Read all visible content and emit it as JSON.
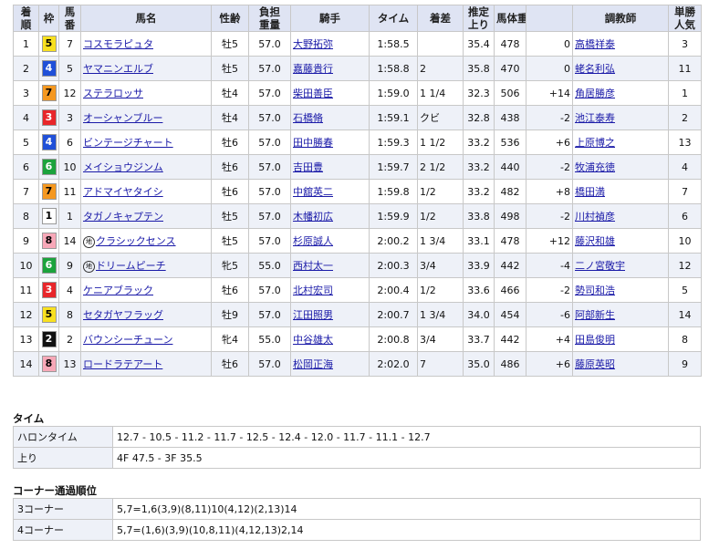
{
  "headers": [
    "着順",
    "枠",
    "馬番",
    "馬名",
    "性齢",
    "負担重量",
    "騎手",
    "タイム",
    "着差",
    "推定上り",
    "馬体重",
    "",
    "調教師",
    "単勝人気"
  ],
  "header_lines": [
    [
      "着",
      "順"
    ],
    [
      "枠"
    ],
    [
      "馬",
      "番"
    ],
    [
      "馬名"
    ],
    [
      "性齢"
    ],
    [
      "負担",
      "重量"
    ],
    [
      "騎手"
    ],
    [
      "タイム"
    ],
    [
      "着差"
    ],
    [
      "推定",
      "上り"
    ],
    [
      "馬体重"
    ],
    [
      ""
    ],
    [
      "調教師"
    ],
    [
      "単勝",
      "人気"
    ]
  ],
  "waku_colors": {
    "1": {
      "bg": "#ffffff",
      "fg": "#000000"
    },
    "2": {
      "bg": "#111111",
      "fg": "#ffffff"
    },
    "3": {
      "bg": "#e8262a",
      "fg": "#ffffff"
    },
    "4": {
      "bg": "#2050d8",
      "fg": "#ffffff"
    },
    "5": {
      "bg": "#f8e020",
      "fg": "#000000"
    },
    "6": {
      "bg": "#1ca33c",
      "fg": "#ffffff"
    },
    "7": {
      "bg": "#f59820",
      "fg": "#000000"
    },
    "8": {
      "bg": "#f7a8b8",
      "fg": "#000000"
    }
  },
  "rows": [
    {
      "rank": "1",
      "waku": "5",
      "num": "7",
      "mark": "",
      "name": "コスモラピュタ",
      "sex_age": "牡5",
      "weight": "57.0",
      "jockey": "大野拓弥",
      "time": "1:58.5",
      "margin": "",
      "last3f": "35.4",
      "body": "478",
      "diff": "0",
      "trainer": "高橋祥泰",
      "pop": "3"
    },
    {
      "rank": "2",
      "waku": "4",
      "num": "5",
      "mark": "",
      "name": "ヤマニンエルブ",
      "sex_age": "牡5",
      "weight": "57.0",
      "jockey": "嘉藤貴行",
      "time": "1:58.8",
      "margin": "2",
      "last3f": "35.8",
      "body": "470",
      "diff": "0",
      "trainer": "蛯名利弘",
      "pop": "11"
    },
    {
      "rank": "3",
      "waku": "7",
      "num": "12",
      "mark": "",
      "name": "ステラロッサ",
      "sex_age": "牡4",
      "weight": "57.0",
      "jockey": "柴田善臣",
      "time": "1:59.0",
      "margin": "1 1/4",
      "last3f": "32.3",
      "body": "506",
      "diff": "+14",
      "trainer": "角居勝彦",
      "pop": "1"
    },
    {
      "rank": "4",
      "waku": "3",
      "num": "3",
      "mark": "",
      "name": "オーシャンブルー",
      "sex_age": "牡4",
      "weight": "57.0",
      "jockey": "石橋脩",
      "time": "1:59.1",
      "margin": "クビ",
      "last3f": "32.8",
      "body": "438",
      "diff": "-2",
      "trainer": "池江泰寿",
      "pop": "2"
    },
    {
      "rank": "5",
      "waku": "4",
      "num": "6",
      "mark": "",
      "name": "ビンテージチャート",
      "sex_age": "牡6",
      "weight": "57.0",
      "jockey": "田中勝春",
      "time": "1:59.3",
      "margin": "1 1/2",
      "last3f": "33.2",
      "body": "536",
      "diff": "+6",
      "trainer": "上原博之",
      "pop": "13"
    },
    {
      "rank": "6",
      "waku": "6",
      "num": "10",
      "mark": "",
      "name": "メイショウジンム",
      "sex_age": "牡6",
      "weight": "57.0",
      "jockey": "吉田豊",
      "time": "1:59.7",
      "margin": "2 1/2",
      "last3f": "33.2",
      "body": "440",
      "diff": "-2",
      "trainer": "牧浦充徳",
      "pop": "4"
    },
    {
      "rank": "7",
      "waku": "7",
      "num": "11",
      "mark": "",
      "name": "アドマイヤタイシ",
      "sex_age": "牡6",
      "weight": "57.0",
      "jockey": "中舘英二",
      "time": "1:59.8",
      "margin": "1/2",
      "last3f": "33.2",
      "body": "482",
      "diff": "+8",
      "trainer": "橋田満",
      "pop": "7"
    },
    {
      "rank": "8",
      "waku": "1",
      "num": "1",
      "mark": "",
      "name": "タガノキャプテン",
      "sex_age": "牡5",
      "weight": "57.0",
      "jockey": "木幡初広",
      "time": "1:59.9",
      "margin": "1/2",
      "last3f": "33.8",
      "body": "498",
      "diff": "-2",
      "trainer": "川村禎彦",
      "pop": "6"
    },
    {
      "rank": "9",
      "waku": "8",
      "num": "14",
      "mark": "地",
      "name": "クラシックセンス",
      "sex_age": "牡5",
      "weight": "57.0",
      "jockey": "杉原誠人",
      "time": "2:00.2",
      "margin": "1 3/4",
      "last3f": "33.1",
      "body": "478",
      "diff": "+12",
      "trainer": "藤沢和雄",
      "pop": "10"
    },
    {
      "rank": "10",
      "waku": "6",
      "num": "9",
      "mark": "地",
      "name": "ドリームピーチ",
      "sex_age": "牝5",
      "weight": "55.0",
      "jockey": "西村太一",
      "time": "2:00.3",
      "margin": "3/4",
      "last3f": "33.9",
      "body": "442",
      "diff": "-4",
      "trainer": "二ノ宮敬宇",
      "pop": "12"
    },
    {
      "rank": "11",
      "waku": "3",
      "num": "4",
      "mark": "",
      "name": "ケニアブラック",
      "sex_age": "牡6",
      "weight": "57.0",
      "jockey": "北村宏司",
      "time": "2:00.4",
      "margin": "1/2",
      "last3f": "33.6",
      "body": "466",
      "diff": "-2",
      "trainer": "勢司和浩",
      "pop": "5"
    },
    {
      "rank": "12",
      "waku": "5",
      "num": "8",
      "mark": "",
      "name": "セタガヤフラッグ",
      "sex_age": "牡9",
      "weight": "57.0",
      "jockey": "江田照男",
      "time": "2:00.7",
      "margin": "1 3/4",
      "last3f": "34.0",
      "body": "454",
      "diff": "-6",
      "trainer": "阿部新生",
      "pop": "14"
    },
    {
      "rank": "13",
      "waku": "2",
      "num": "2",
      "mark": "",
      "name": "バウンシーチューン",
      "sex_age": "牝4",
      "weight": "55.0",
      "jockey": "中谷雄太",
      "time": "2:00.8",
      "margin": "3/4",
      "last3f": "33.7",
      "body": "442",
      "diff": "+4",
      "trainer": "田島俊明",
      "pop": "8"
    },
    {
      "rank": "14",
      "waku": "8",
      "num": "13",
      "mark": "",
      "name": "ロードラテアート",
      "sex_age": "牡6",
      "weight": "57.0",
      "jockey": "松岡正海",
      "time": "2:02.0",
      "margin": "7",
      "last3f": "35.0",
      "body": "486",
      "diff": "+6",
      "trainer": "藤原英昭",
      "pop": "9"
    }
  ],
  "time_section": {
    "title": "タイム",
    "rows": [
      {
        "label": "ハロンタイム",
        "value": "12.7 - 10.5 - 11.2 - 11.7 - 12.5 - 12.4 - 12.0 - 11.7 - 11.1 - 12.7"
      },
      {
        "label": "上り",
        "value": "4F 47.5 - 3F 35.5"
      }
    ]
  },
  "corner_section": {
    "title": "コーナー通過順位",
    "rows": [
      {
        "label": "3コーナー",
        "value": "5,7=1,6(3,9)(8,11)10(4,12)(2,13)14"
      },
      {
        "label": "4コーナー",
        "value": "5,7=(1,6)(3,9)(10,8,11)(4,12,13)2,14"
      }
    ]
  }
}
